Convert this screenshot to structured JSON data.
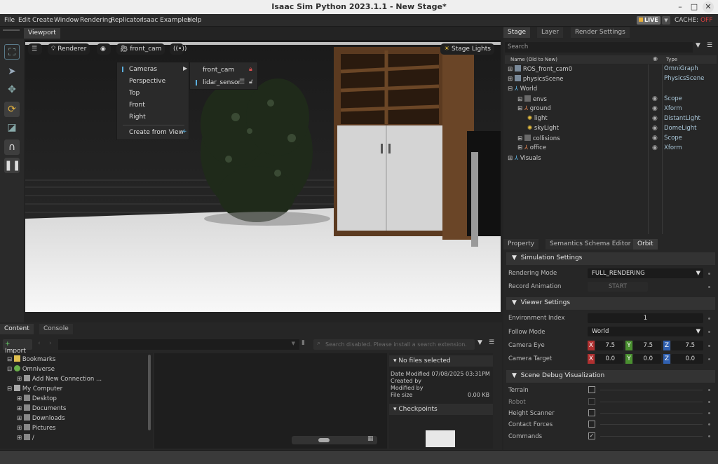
{
  "window": {
    "title": "Isaac Sim Python 2023.1.1 - New Stage*"
  },
  "menubar": [
    "File",
    "Edit",
    "Create",
    "Window",
    "Rendering",
    "Replicator",
    "Isaac Examples",
    "Help"
  ],
  "live": {
    "label": "LIVE",
    "cache_label": "CACHE:",
    "cache_state": "OFF"
  },
  "viewport": {
    "tab": "Viewport",
    "renderer_label": "Renderer",
    "camera_label": "front_cam",
    "stage_lights_label": "Stage Lights",
    "menu": {
      "items": [
        "Cameras",
        "Perspective",
        "Top",
        "Front",
        "Right",
        "Create from View"
      ],
      "submenu": [
        "front_cam",
        "lidar_sensor"
      ]
    }
  },
  "bottom": {
    "tabs": [
      "Content",
      "Console"
    ],
    "import_label": "Import",
    "search_placeholder": "Search disabled. Please install a search extension.",
    "tree": [
      "Bookmarks",
      "Omniverse",
      "Add New Connection ...",
      "My Computer",
      "Desktop",
      "Documents",
      "Downloads",
      "Pictures",
      "/"
    ],
    "info": {
      "header": "No files selected",
      "date_modified_label": "Date Modified",
      "date_modified": "07/08/2025 03:31PM",
      "created_by_label": "Created by",
      "modified_by_label": "Modified by",
      "file_size_label": "File size",
      "file_size": "0.00 KB",
      "checkpoints_label": "Checkpoints"
    }
  },
  "stage": {
    "tabs": [
      "Stage",
      "Layer",
      "Render Settings"
    ],
    "search_placeholder": "Search",
    "col_name": "Name (Old to New)",
    "col_type": "Type",
    "rows": [
      {
        "name": "ROS_front_cam0",
        "type": "OmniGraph"
      },
      {
        "name": "physicsScene",
        "type": "PhysicsScene"
      },
      {
        "name": "World",
        "type": ""
      },
      {
        "name": "envs",
        "type": "Scope"
      },
      {
        "name": "ground",
        "type": "Xform"
      },
      {
        "name": "light",
        "type": "DistantLight"
      },
      {
        "name": "skyLight",
        "type": "DomeLight"
      },
      {
        "name": "collisions",
        "type": "Scope"
      },
      {
        "name": "office",
        "type": "Xform"
      },
      {
        "name": "Visuals",
        "type": ""
      }
    ]
  },
  "props": {
    "tabs": [
      "Property",
      "Semantics Schema Editor",
      "Orbit"
    ],
    "sim_settings": "Simulation Settings",
    "rendering_mode_label": "Rendering Mode",
    "rendering_mode": "FULL_RENDERING",
    "record_animation_label": "Record Animation",
    "start_label": "START",
    "viewer_settings": "Viewer Settings",
    "env_index_label": "Environment Index",
    "env_index": "1",
    "follow_mode_label": "Follow Mode",
    "follow_mode": "World",
    "camera_eye_label": "Camera Eye",
    "camera_eye": [
      "7.5",
      "7.5",
      "7.5"
    ],
    "camera_target_label": "Camera Target",
    "camera_target": [
      "0.0",
      "0.0",
      "0.0"
    ],
    "axis": [
      "X",
      "Y",
      "Z"
    ],
    "scene_debug": "Scene Debug Visualization",
    "debug_items": [
      "Terrain",
      "Robot",
      "Height Scanner",
      "Contact Forces",
      "Commands"
    ]
  }
}
